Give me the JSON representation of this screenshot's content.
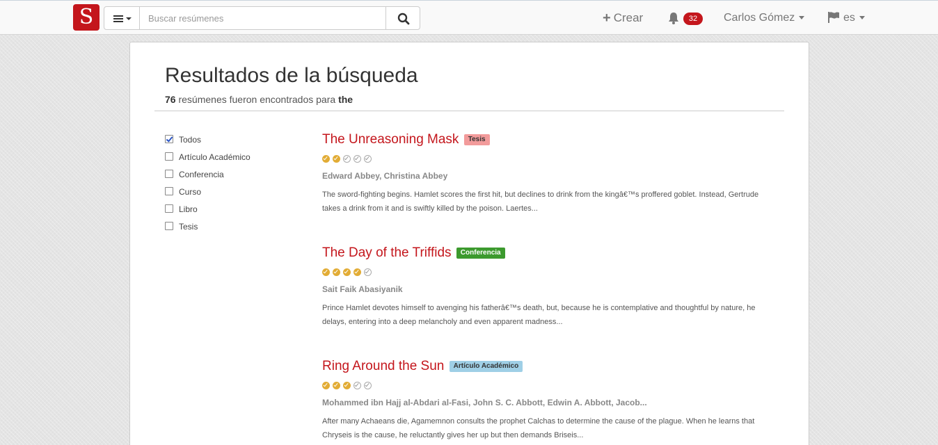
{
  "navbar": {
    "logo_letter": "S",
    "search_placeholder": "Buscar resúmenes",
    "create_label": "Crear",
    "notifications_count": "32",
    "user_name": "Carlos Gómez",
    "language": "es"
  },
  "page": {
    "title": "Resultados de la búsqueda",
    "result_count": "76",
    "summary_text": "resúmenes fueron encontrados para",
    "query": "the"
  },
  "filters": [
    {
      "label": "Todos",
      "checked": true
    },
    {
      "label": "Artículo Académico",
      "checked": false
    },
    {
      "label": "Conferencia",
      "checked": false
    },
    {
      "label": "Curso",
      "checked": false
    },
    {
      "label": "Libro",
      "checked": false
    },
    {
      "label": "Tesis",
      "checked": false
    }
  ],
  "results": [
    {
      "title": "The Unreasoning Mask",
      "tag": "Tesis",
      "tag_bg": "#f29b9b",
      "tag_color": "#333333",
      "rating": 2,
      "authors": "Edward Abbey, Christina Abbey",
      "description": "The sword-fighting begins. Hamlet scores the first hit, but declines to drink from the kingâ€™s proffered goblet. Instead, Gertrude takes a drink from it and is swiftly killed by the poison. Laertes..."
    },
    {
      "title": "The Day of the Triffids",
      "tag": "Conferencia",
      "tag_bg": "#3c9a2e",
      "tag_color": "#ffffff",
      "rating": 4,
      "authors": "Sait Faik Abasiyanik",
      "description": "Prince Hamlet devotes himself to avenging his fatherâ€™s death, but, because he is contemplative and thoughtful by nature, he delays, entering into a deep melancholy and even apparent madness..."
    },
    {
      "title": "Ring Around the Sun",
      "tag": "Artículo Académico",
      "tag_bg": "#9fcfe6",
      "tag_color": "#333333",
      "rating": 3,
      "authors": "Mohammed ibn Hajj al-Abdari al-Fasi, John S. C. Abbott, Edwin A. Abbott, Jacob...",
      "description": "After many Achaeans die, Agamemnon consults the prophet Calchas to determine the cause of the plague. When he learns that Chryseis is the cause, he reluctantly gives her up but then demands Briseis..."
    }
  ]
}
